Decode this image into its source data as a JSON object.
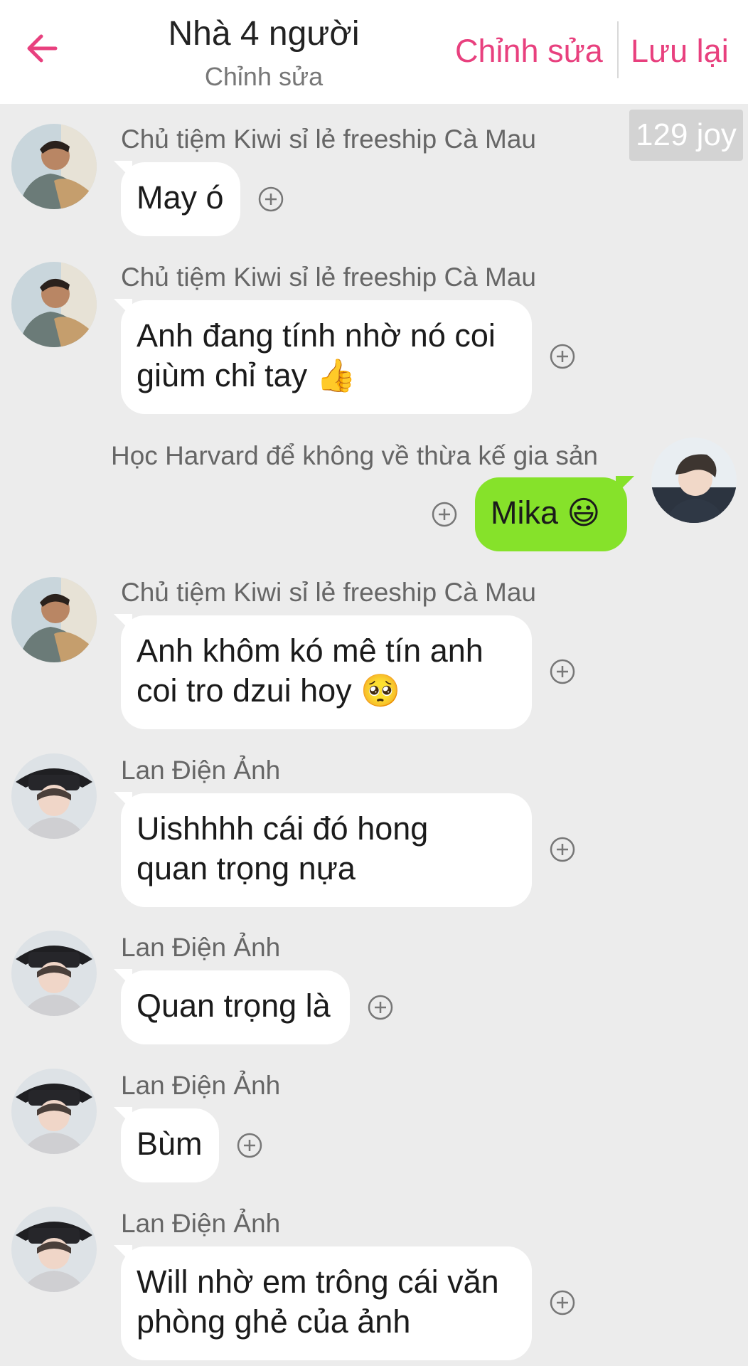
{
  "header": {
    "title": "Nhà 4 người",
    "subtitle": "Chỉnh sửa",
    "edit_label": "Chỉnh sửa",
    "save_label": "Lưu lại",
    "accent_color": "#e8407e"
  },
  "badge": {
    "joy": "129 joy"
  },
  "messages": [
    {
      "sender": "Chủ tiệm Kiwi sỉ lẻ freeship Cà Mau",
      "line1": "May ó",
      "line2": ""
    },
    {
      "sender": "Chủ tiệm Kiwi sỉ lẻ freeship Cà Mau",
      "line1": "Anh đang tính nhờ nó coi",
      "line2": "giùm chỉ tay 👍"
    },
    {
      "sender": "Học Harvard để không về thừa kế gia sản",
      "line1": "Mika 😃",
      "line2": ""
    },
    {
      "sender": "Chủ tiệm Kiwi sỉ lẻ freeship Cà Mau",
      "line1": "Anh khôm kó mê tín anh",
      "line2": "coi tro dzui hoy 🥺"
    },
    {
      "sender": "Lan Điện Ảnh",
      "line1": "Uishhhh cái đó hong",
      "line2": "quan trọng nựa"
    },
    {
      "sender": "Lan Điện Ảnh",
      "line1": "Quan trọng là",
      "line2": ""
    },
    {
      "sender": "Lan Điện Ảnh",
      "line1": "Bùm",
      "line2": ""
    },
    {
      "sender": "Lan Điện Ảnh",
      "line1": "Will nhờ em trông cái văn",
      "line2": "phòng ghẻ của ảnh"
    }
  ],
  "colors": {
    "my_bubble": "#86e22a",
    "other_bubble": "#ffffff",
    "background": "#ececec"
  },
  "icons": {
    "back": "arrow-left-icon",
    "add_reaction": "plus-circle-icon"
  }
}
